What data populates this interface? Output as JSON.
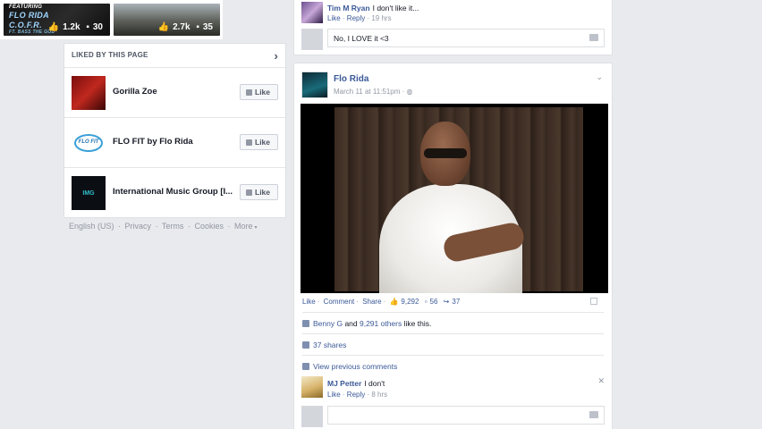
{
  "left": {
    "photos": [
      {
        "overlay_top": "FEATURING",
        "overlay_title": "FLO RIDA",
        "overlay_sub": "C.O.F.R.",
        "overlay_credit": "FT. BASS THE GOD",
        "likes": "1.2k",
        "comments": "30"
      },
      {
        "likes": "2.7k",
        "comments": "35"
      }
    ],
    "liked_by": {
      "header": "LIKED BY THIS PAGE",
      "items": [
        {
          "name": "Gorilla Zoe",
          "button": "Like"
        },
        {
          "name": "FLO FIT by Flo Rida",
          "button": "Like",
          "logo_text": "FLO FIT"
        },
        {
          "name": "International Music Group [I...",
          "button": "Like",
          "logo_text": "IMG"
        }
      ]
    },
    "footer": [
      "English (US)",
      "·",
      "Privacy",
      "·",
      "Terms",
      "·",
      "Cookies",
      "·",
      "More",
      "▾"
    ]
  },
  "prev_post": {
    "comment": {
      "author": "Tim M Ryan",
      "text": "I don't like it...",
      "like": "Like",
      "reply": "Reply",
      "time": "19 hrs"
    },
    "input_value": "No, I LOVE it <3"
  },
  "post": {
    "page_name": "Flo Rida",
    "timestamp": "March 11 at 11:51pm",
    "actions": {
      "like": "Like",
      "comment": "Comment",
      "share": "Share",
      "likes_count": "9,292",
      "comments_count": "56",
      "shares_count": "37"
    },
    "likes_line_link1": "Benny G",
    "likes_line_plain1": " and ",
    "likes_line_link2": "9,291 others",
    "likes_line_plain2": " like this.",
    "shares_line": "37 shares",
    "view_previous": "View previous comments",
    "comment": {
      "author": "MJ Petter",
      "text": "I don't",
      "like": "Like",
      "reply": "Reply",
      "time": "8 hrs"
    },
    "input_placeholder": ""
  },
  "colors": {
    "link": "#3b5998",
    "background": "#e9eaed",
    "muted": "#9197a3"
  }
}
